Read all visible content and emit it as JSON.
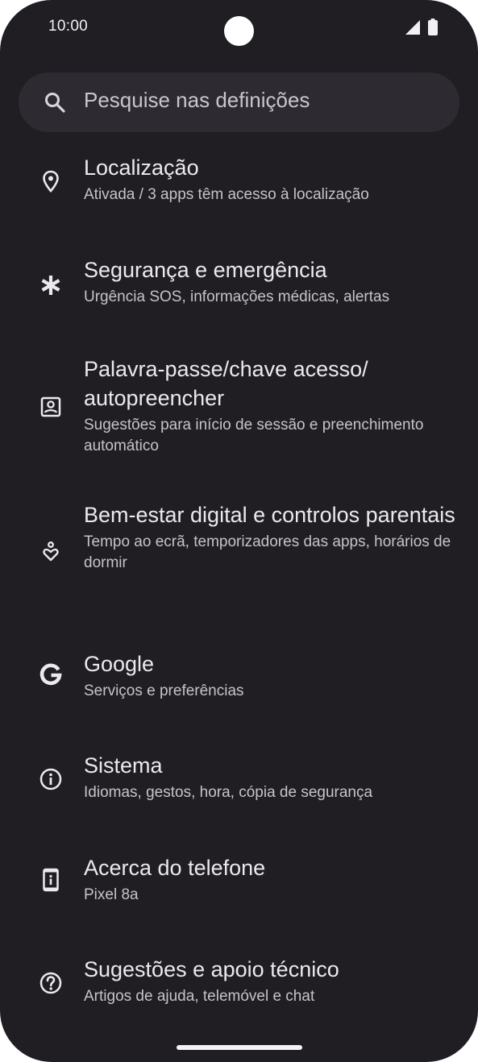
{
  "status_bar": {
    "time": "10:00"
  },
  "search": {
    "placeholder": "Pesquise nas definições"
  },
  "settings_items": [
    {
      "icon": "location-pin-icon",
      "title": "Localização",
      "subtitle": "Ativada / 3 apps têm acesso à localização"
    },
    {
      "icon": "asterisk-emergency-icon",
      "title": "Segurança e emergência",
      "subtitle": "Urgência SOS, informações médicas, alertas"
    },
    {
      "icon": "password-account-icon",
      "title": "Palavra-passe/chave acesso/ autopreencher",
      "subtitle": "Sugestões para início de sessão e preenchimento automático"
    },
    {
      "icon": "digital-wellbeing-icon",
      "title": "Bem-estar digital e controlos parentais",
      "subtitle": "Tempo ao ecrã, temporizadores das apps, horários de dormir"
    },
    {
      "icon": "google-g-icon",
      "title": "Google",
      "subtitle": "Serviços e preferências"
    },
    {
      "icon": "info-icon",
      "title": "Sistema",
      "subtitle": "Idiomas, gestos, hora, cópia de segurança"
    },
    {
      "icon": "phone-info-icon",
      "title": "Acerca do telefone",
      "subtitle": "Pixel 8a"
    },
    {
      "icon": "help-icon",
      "title": "Sugestões e apoio técnico",
      "subtitle": "Artigos de ajuda, telemóvel e chat"
    }
  ],
  "colors": {
    "background": "#201e23",
    "search_background": "#2d2b31",
    "title_text": "#ece8ef",
    "subtitle_text": "#c6c2ca"
  }
}
